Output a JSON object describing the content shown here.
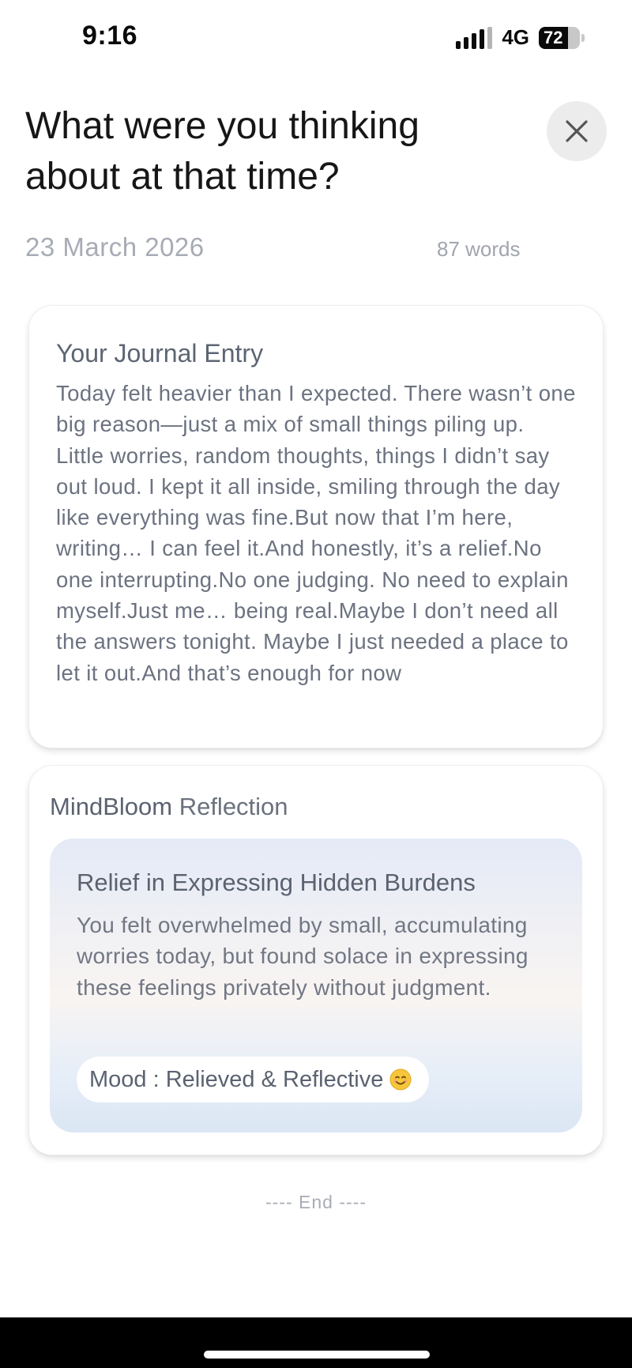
{
  "status_bar": {
    "time": "9:16",
    "network": "4G",
    "battery": "72",
    "battery_level": 0.72
  },
  "header": {
    "title": "What were you thinking about at that time?",
    "close_icon": "close-icon",
    "date": "23 March 2026",
    "word_count": "87 words"
  },
  "journal_entry": {
    "heading": "Your Journal Entry",
    "body": "Today felt heavier than I expected. There wasn’t one big reason—just a mix of small things piling up. Little worries, random thoughts, things I didn’t say out loud. I kept it all inside, smiling through the day like everything was fine.But now that I’m here, writing… I can feel it.And honestly, it’s a relief.No one interrupting.No one judging. No need to explain myself.Just me… being real.Maybe I don’t need all the answers tonight. Maybe I just needed a place to let it out.And that’s enough for now"
  },
  "reflection": {
    "brand": "MindBloom",
    "label": "Reflection",
    "insight_title": "Relief in Expressing Hidden Burdens",
    "insight_text": "You felt overwhelmed by small, accumulating worries today, but found solace in expressing these feelings privately without judgment.",
    "mood": "Mood : Relieved & Reflective",
    "mood_icon": "smiling-face-icon"
  },
  "footer": {
    "end_marker": "---- End ----"
  },
  "colors": {
    "title": "#161616",
    "muted_text": "#6c7280",
    "card_border": "#eeeeee",
    "insight_gradient_top": "#e4eaf7",
    "insight_gradient_bottom": "#dbe6f4"
  }
}
